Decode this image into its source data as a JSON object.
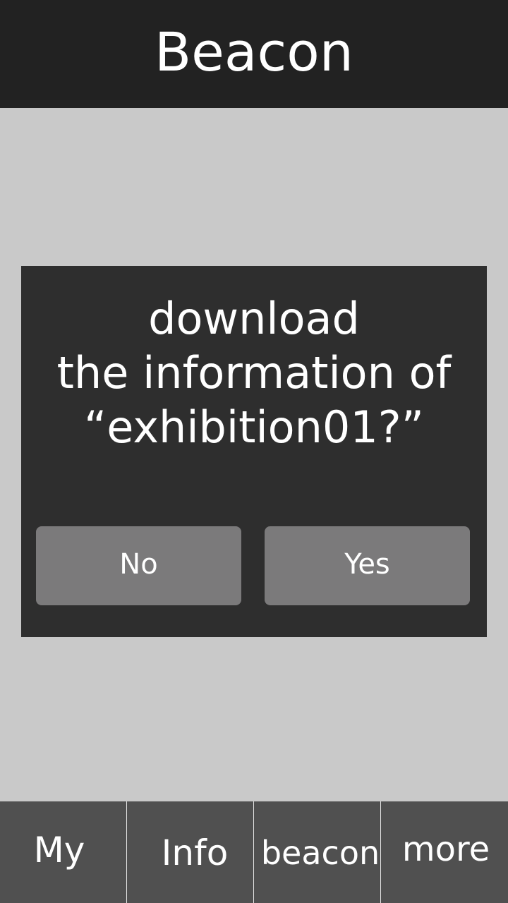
{
  "header": {
    "title": "Beacon"
  },
  "dialog": {
    "message_lines": [
      "download",
      "the information of",
      "“exhibition01?”"
    ],
    "no_label": "No",
    "yes_label": "Yes"
  },
  "tabbar": {
    "items": [
      {
        "label": "My"
      },
      {
        "label": "Info"
      },
      {
        "label": "beacon"
      },
      {
        "label": "more"
      }
    ]
  },
  "colors": {
    "header_bg": "#222222",
    "page_bg": "#c9c9c9",
    "dialog_bg": "#2e2e2e",
    "button_bg": "#7b7a7b",
    "tabbar_bg": "#505050"
  }
}
